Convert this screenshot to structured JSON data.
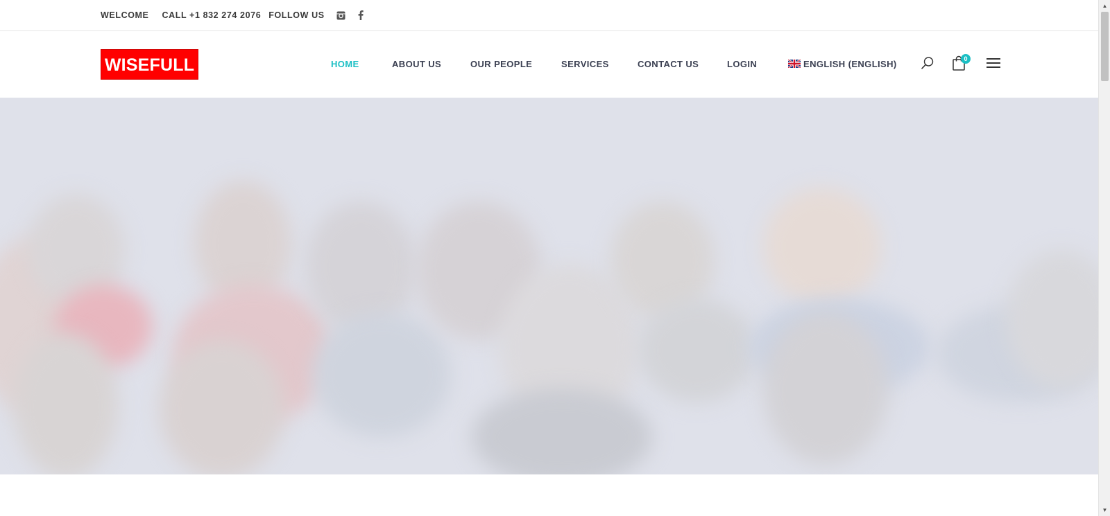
{
  "topbar": {
    "welcome": "WELCOME",
    "phone": "CALL +1 832 274 2076",
    "follow": "FOLLOW US",
    "social_icons": [
      "instagram-icon",
      "facebook-icon"
    ]
  },
  "header": {
    "logo_text": "WISEFULL",
    "nav": [
      {
        "label": "HOME",
        "active": true
      },
      {
        "label": "ABOUT US",
        "active": false
      },
      {
        "label": "OUR PEOPLE",
        "active": false
      },
      {
        "label": "SERVICES",
        "active": false
      },
      {
        "label": "CONTACT US",
        "active": false
      },
      {
        "label": "LOGIN",
        "active": false
      }
    ],
    "language": "ENGLISH (ENGLISH)",
    "cart_count": "0",
    "icons": [
      "search-icon",
      "cart-icon",
      "menu-icon"
    ]
  },
  "colors": {
    "accent": "#1bbfc4",
    "logo_bg": "#ff0000",
    "nav_text": "#3b4052"
  }
}
